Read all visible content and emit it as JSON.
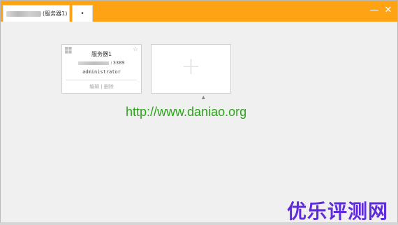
{
  "titlebar": {
    "active_tab_label": "(服务器1)",
    "new_tab_label": "•",
    "minimize_label": "—",
    "close_label": "✕",
    "accent_color": "#fda314"
  },
  "server_card": {
    "name": "服务器1",
    "address_suffix": ":3389",
    "username": "administrator",
    "actions_label": "编辑 | 删除",
    "star_icon": "star-outline-icon",
    "os_icon": "windows-icon"
  },
  "add_card": {
    "plus_symbol": "+",
    "caret": "▲"
  },
  "watermarks": {
    "url": "http://www.daniao.org",
    "brand": "优乐评测网"
  }
}
